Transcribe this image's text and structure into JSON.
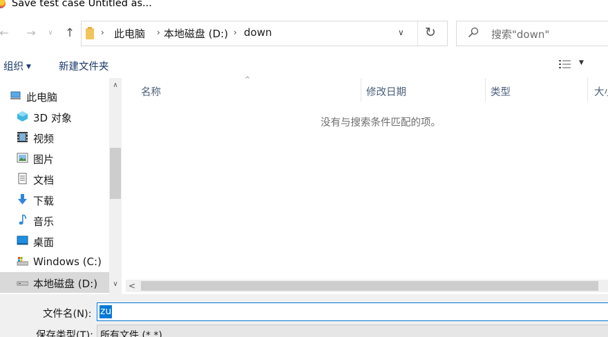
{
  "window": {
    "title": "Save test case Untitled as..."
  },
  "nav": {
    "back": "←",
    "forward": "→",
    "recent": "∨",
    "up": "↑"
  },
  "address": {
    "separator": "›",
    "crumbs": [
      "此电脑",
      "本地磁盘 (D:)",
      "down"
    ],
    "dropdown": "∨",
    "refresh": "↻"
  },
  "search": {
    "placeholder": "搜索\"down\""
  },
  "toolbar": {
    "organize": "组织",
    "organize_arrow": "▼",
    "new_folder": "新建文件夹",
    "view_arrow": "▼"
  },
  "tree": {
    "items": [
      {
        "label": "此电脑",
        "icon": "computer-icon"
      },
      {
        "label": "3D 对象",
        "icon": "3d-objects-icon"
      },
      {
        "label": "视频",
        "icon": "video-icon"
      },
      {
        "label": "图片",
        "icon": "pictures-icon"
      },
      {
        "label": "文档",
        "icon": "documents-icon"
      },
      {
        "label": "下载",
        "icon": "download-icon"
      },
      {
        "label": "音乐",
        "icon": "music-icon"
      },
      {
        "label": "桌面",
        "icon": "desktop-icon"
      },
      {
        "label": "Windows (C:)",
        "icon": "drive-c-icon"
      },
      {
        "label": "本地磁盘 (D:)",
        "icon": "drive-d-icon",
        "selected": true
      }
    ]
  },
  "columns": [
    "名称",
    "修改日期",
    "类型",
    "大小"
  ],
  "empty_message": "没有与搜索条件匹配的项。",
  "scroll": {
    "up": "∧",
    "down": "∨",
    "left": "<"
  },
  "save": {
    "filename_label": "文件名(N):",
    "filename_value": "zu",
    "type_label": "保存类型(T):",
    "type_value": "所有文件 (*.*)"
  },
  "colors": {
    "accent": "#0078d7",
    "selection_bg": "#d9d9d9",
    "header_text": "#4c607a"
  }
}
